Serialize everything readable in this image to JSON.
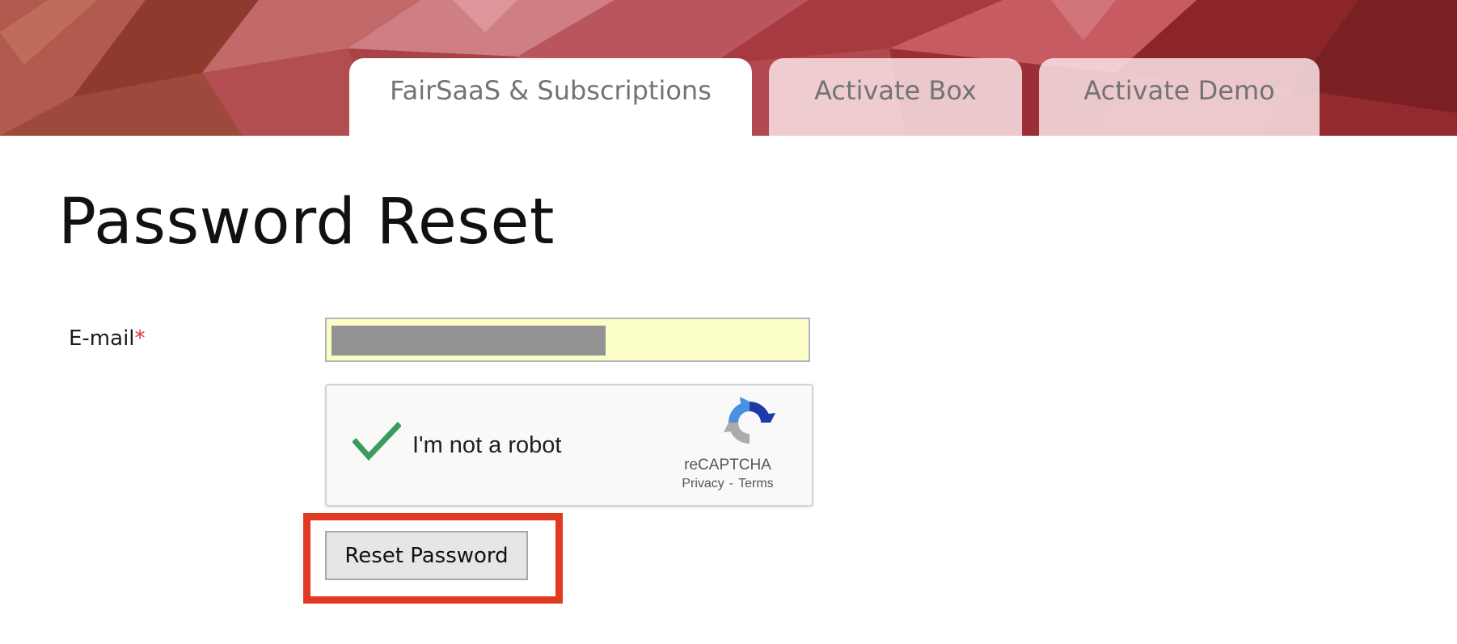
{
  "header": {
    "tabs": [
      {
        "label": "FairSaaS & Subscriptions",
        "active": true
      },
      {
        "label": "Activate Box",
        "active": false
      },
      {
        "label": "Activate Demo",
        "active": false
      }
    ],
    "banner_color": "#a83a3c"
  },
  "main": {
    "title": "Password Reset",
    "form": {
      "email_label": "E-mail",
      "required_marker": "*",
      "email_value_redacted": true,
      "email_field_bg": "#fbfdc6"
    },
    "recaptcha": {
      "checkbox_state": "checked",
      "label": "I'm not a robot",
      "brand": "reCAPTCHA",
      "privacy_link": "Privacy",
      "separator": "-",
      "terms_link": "Terms",
      "check_icon": "checkmark-icon",
      "logo_icon": "recaptcha-logo-icon"
    },
    "submit": {
      "label": "Reset Password",
      "highlighted": true,
      "highlight_color": "#e23a22"
    }
  }
}
